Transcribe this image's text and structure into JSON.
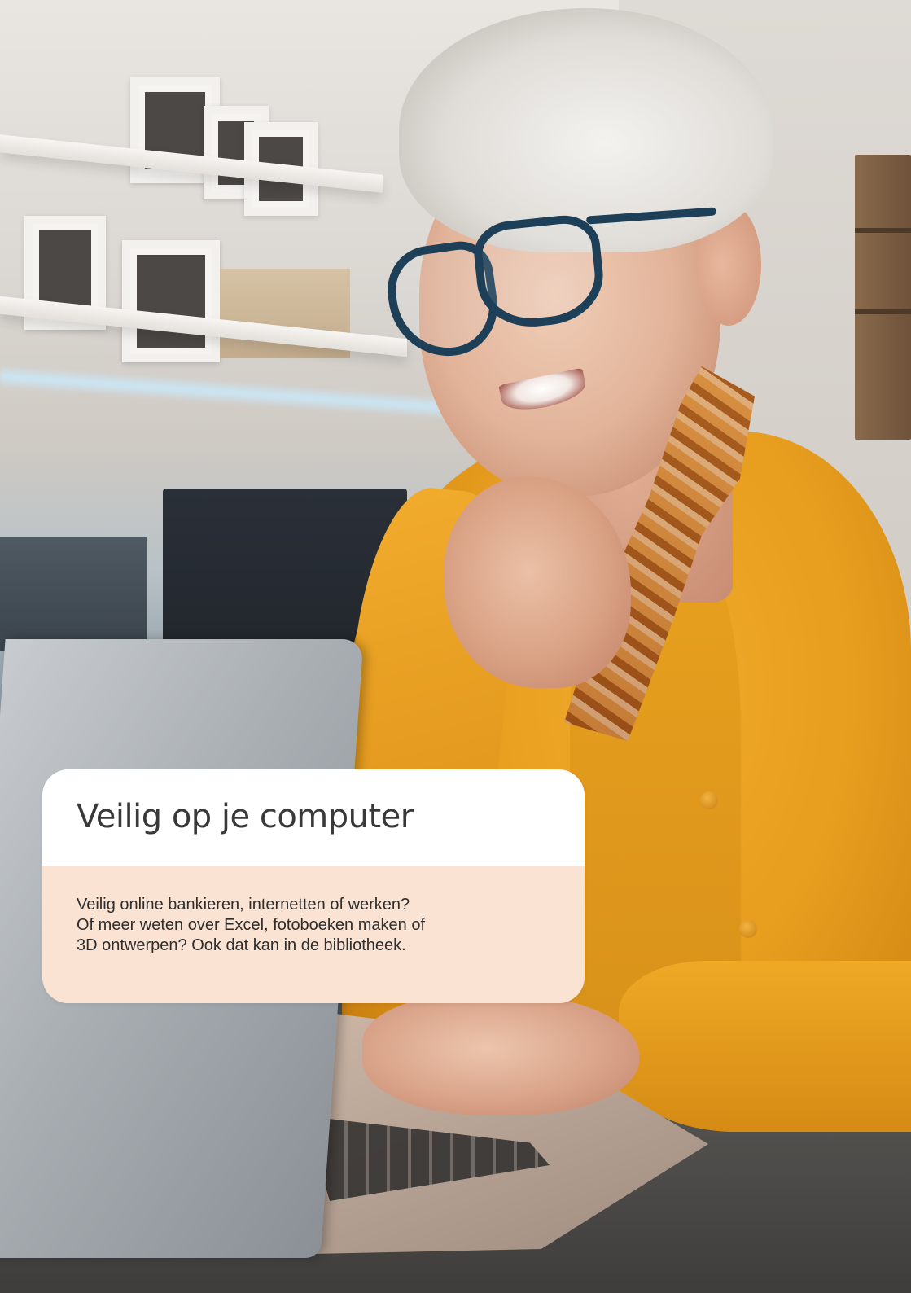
{
  "card": {
    "title": "Veilig op je computer",
    "body_lines": [
      "Veilig online bankieren, internetten of werken?",
      "Of meer weten over Excel, fotoboeken maken of",
      "3D ontwerpen? Ook dat kan in de bibliotheek."
    ],
    "header_color": "#ffffff",
    "body_color": "#fbe3d3",
    "title_color": "#3a3939",
    "text_color": "#2e2e2e"
  },
  "photo": {
    "icon": "photo-woman-at-laptop",
    "accent_color": "#e79d1e"
  }
}
